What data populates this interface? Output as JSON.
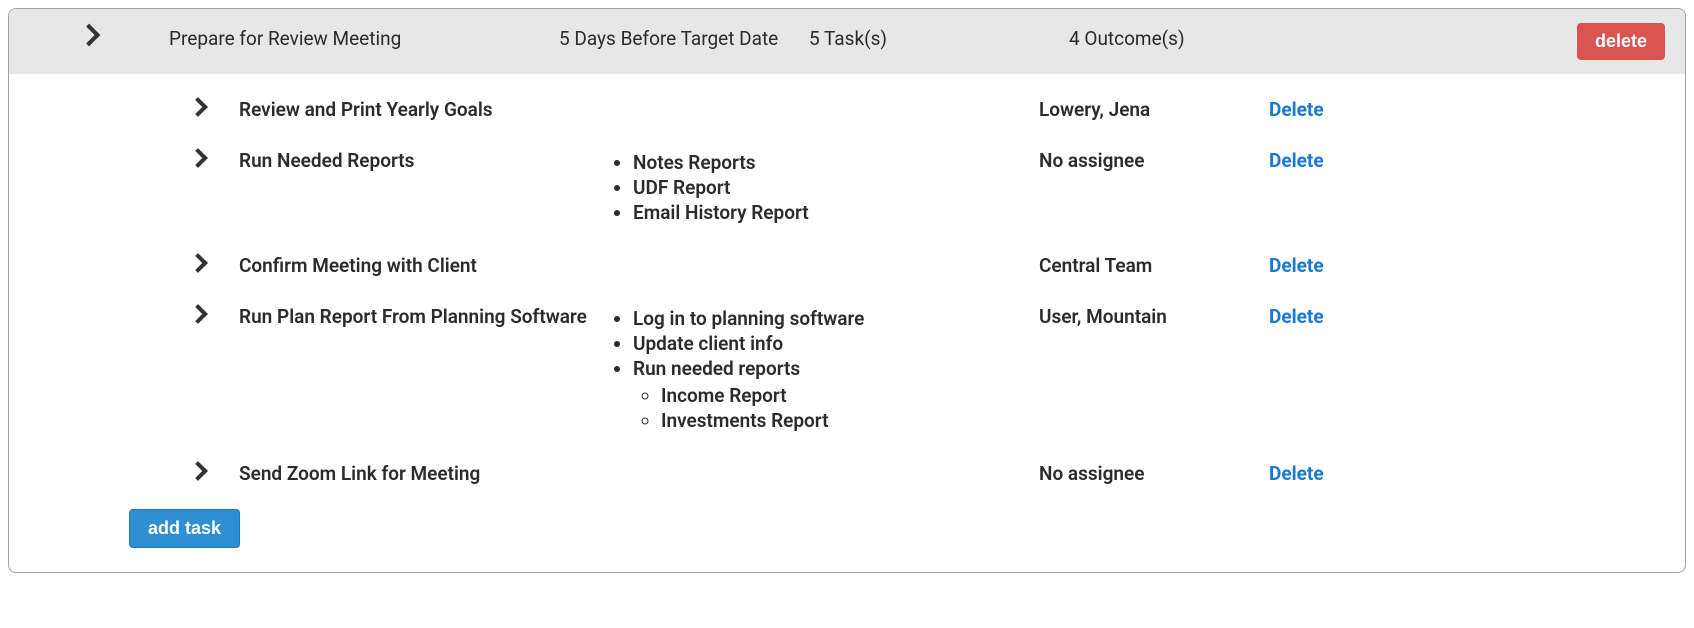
{
  "header": {
    "title": "Prepare for Review Meeting",
    "due": "5 Days Before Target Date",
    "tasks_count": "5 Task(s)",
    "outcomes_count": "4 Outcome(s)",
    "delete_label": "delete"
  },
  "tasks": [
    {
      "name": "Review and Print Yearly Goals",
      "assignee": "Lowery, Jena",
      "delete_label": "Delete",
      "steps": []
    },
    {
      "name": "Run Needed Reports",
      "assignee": "No assignee",
      "delete_label": "Delete",
      "steps": [
        {
          "text": "Notes Reports",
          "sub": []
        },
        {
          "text": "UDF Report",
          "sub": []
        },
        {
          "text": "Email History Report",
          "sub": []
        }
      ]
    },
    {
      "name": "Confirm Meeting with Client",
      "assignee": "Central Team",
      "delete_label": "Delete",
      "steps": []
    },
    {
      "name": "Run Plan Report From Planning Software",
      "assignee": "User, Mountain",
      "delete_label": "Delete",
      "steps": [
        {
          "text": "Log in to planning software",
          "sub": []
        },
        {
          "text": "Update client info",
          "sub": []
        },
        {
          "text": "Run needed reports",
          "sub": [
            "Income Report",
            "Investments Report"
          ]
        }
      ]
    },
    {
      "name": "Send Zoom Link for Meeting",
      "assignee": "No assignee",
      "delete_label": "Delete",
      "steps": []
    }
  ],
  "footer": {
    "add_task_label": "add task"
  }
}
